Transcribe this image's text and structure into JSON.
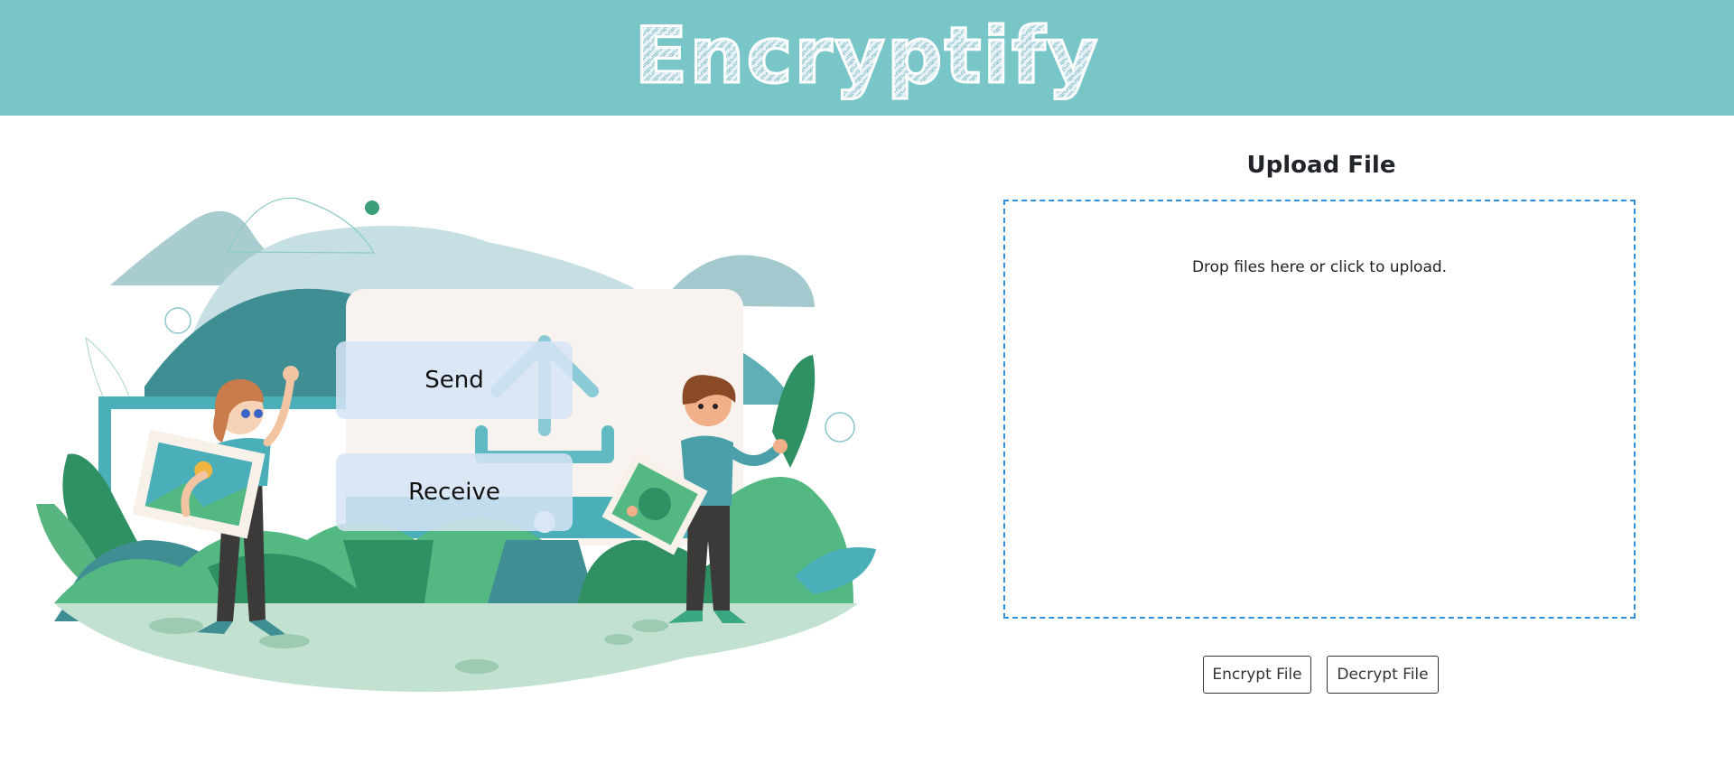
{
  "header": {
    "logo_text": "Encryptify",
    "background_color": "#78c6c8"
  },
  "hero": {
    "send_label": "Send",
    "receive_label": "Receive",
    "illustration_icon": "upload-tray-icon"
  },
  "upload": {
    "title": "Upload File",
    "dropzone_text": "Drop files here or click to upload.",
    "dropzone_border_color": "#2f8fe0",
    "encrypt_label": "Encrypt File",
    "decrypt_label": "Decrypt File"
  }
}
